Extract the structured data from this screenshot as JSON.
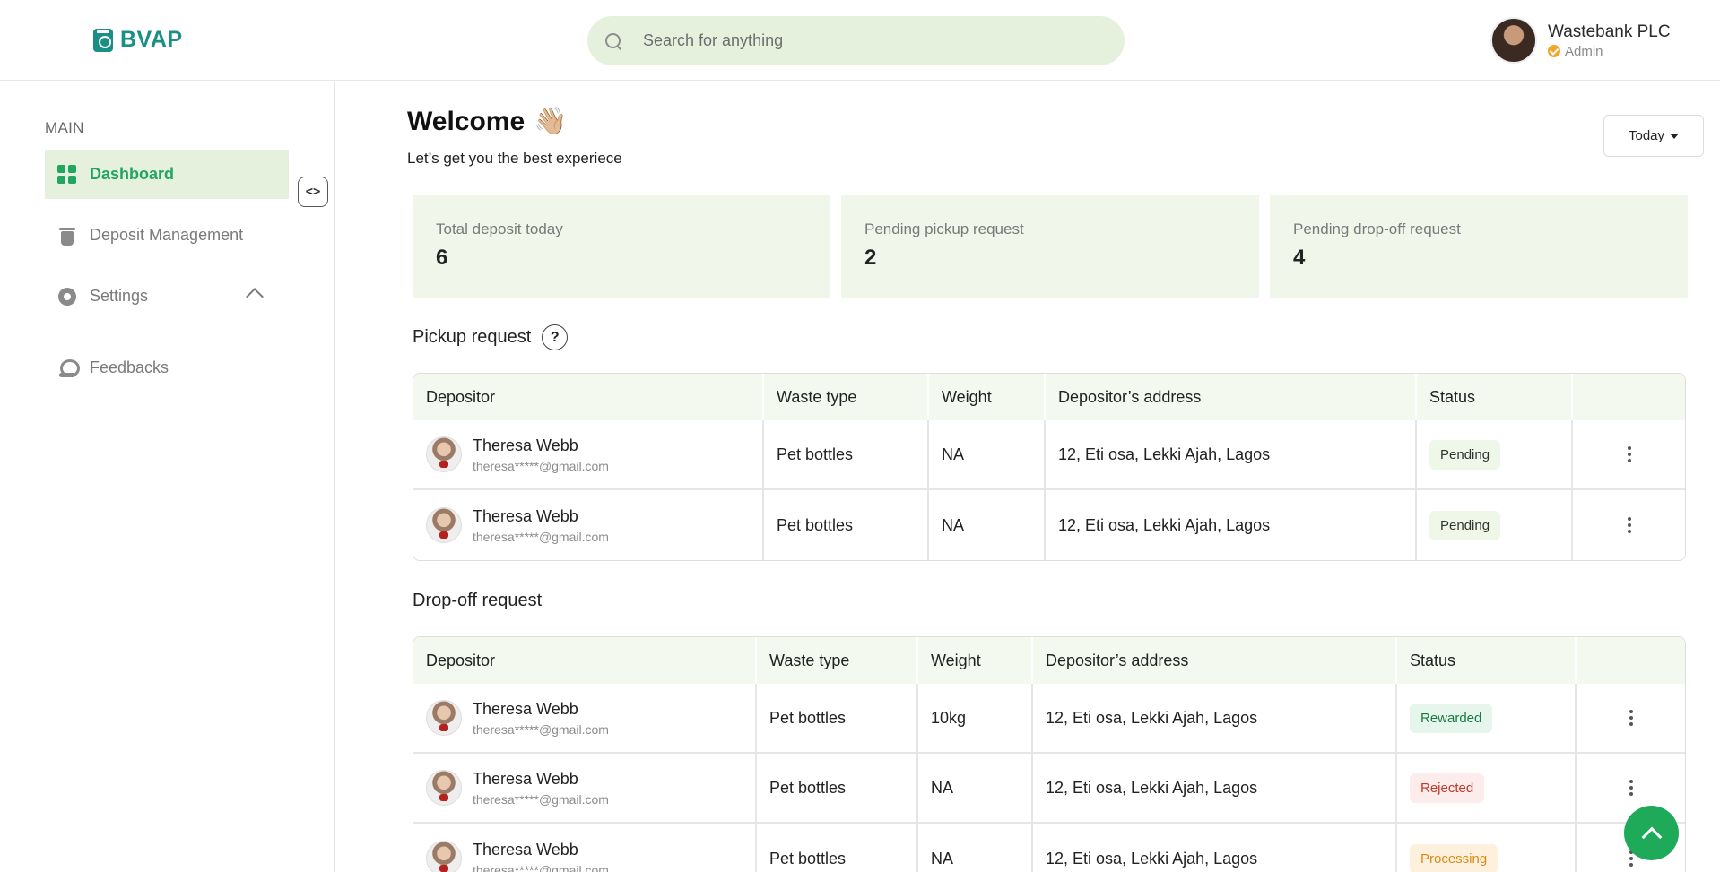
{
  "brand": {
    "name": "BVAP"
  },
  "search": {
    "placeholder": "Search for anything"
  },
  "user": {
    "name": "Wastebank PLC",
    "role": "Admin"
  },
  "sidebar": {
    "section_label": "MAIN",
    "items": [
      {
        "label": "Dashboard",
        "icon": "dashboard-grid-icon",
        "active": true
      },
      {
        "label": "Deposit Management",
        "icon": "bin-icon"
      },
      {
        "label": "Settings",
        "icon": "gear-icon"
      },
      {
        "label": "Feedbacks",
        "icon": "feedback-icon"
      }
    ],
    "collapse_glyph": "<>"
  },
  "main": {
    "title": "Welcome",
    "title_emoji": "👋🏼",
    "subtitle": "Let’s get you the best experiece",
    "period_select": {
      "selected": "Today"
    },
    "stats": [
      {
        "label": "Total deposit today",
        "value": "6"
      },
      {
        "label": "Pending pickup request",
        "value": "2"
      },
      {
        "label": "Pending drop-off request",
        "value": "4"
      }
    ]
  },
  "pickup": {
    "title": "Pickup request",
    "help_glyph": "?",
    "columns": [
      "Depositor",
      "Waste type",
      "Weight",
      "Depositor’s address",
      "Status"
    ],
    "rows": [
      {
        "name": "Theresa Webb",
        "email": "theresa*****@gmail.com",
        "waste": "Pet bottles",
        "weight": "NA",
        "address": "12, Eti osa, Lekki Ajah, Lagos",
        "status": "Pending"
      },
      {
        "name": "Theresa Webb",
        "email": "theresa*****@gmail.com",
        "waste": "Pet bottles",
        "weight": "NA",
        "address": "12, Eti osa, Lekki Ajah, Lagos",
        "status": "Pending"
      }
    ]
  },
  "dropoff": {
    "title": "Drop-off request",
    "columns": [
      "Depositor",
      "Waste type",
      "Weight",
      "Depositor’s address",
      "Status"
    ],
    "rows": [
      {
        "name": "Theresa Webb",
        "email": "theresa*****@gmail.com",
        "waste": "Pet bottles",
        "weight": "10kg",
        "address": "12, Eti osa, Lekki Ajah, Lagos",
        "status": "Rewarded"
      },
      {
        "name": "Theresa Webb",
        "email": "theresa*****@gmail.com",
        "waste": "Pet bottles",
        "weight": "NA",
        "address": "12, Eti osa, Lekki Ajah, Lagos",
        "status": "Rejected"
      },
      {
        "name": "Theresa Webb",
        "email": "theresa*****@gmail.com",
        "waste": "Pet bottles",
        "weight": "NA",
        "address": "12, Eti osa, Lekki Ajah, Lagos",
        "status": "Processing"
      }
    ]
  },
  "colors": {
    "brand": "#1a8f86",
    "accent_green": "#21a560",
    "light_green_bg": "#e6f1dd",
    "status_rejected": "#c0392b",
    "status_processing": "#d98b1a"
  }
}
